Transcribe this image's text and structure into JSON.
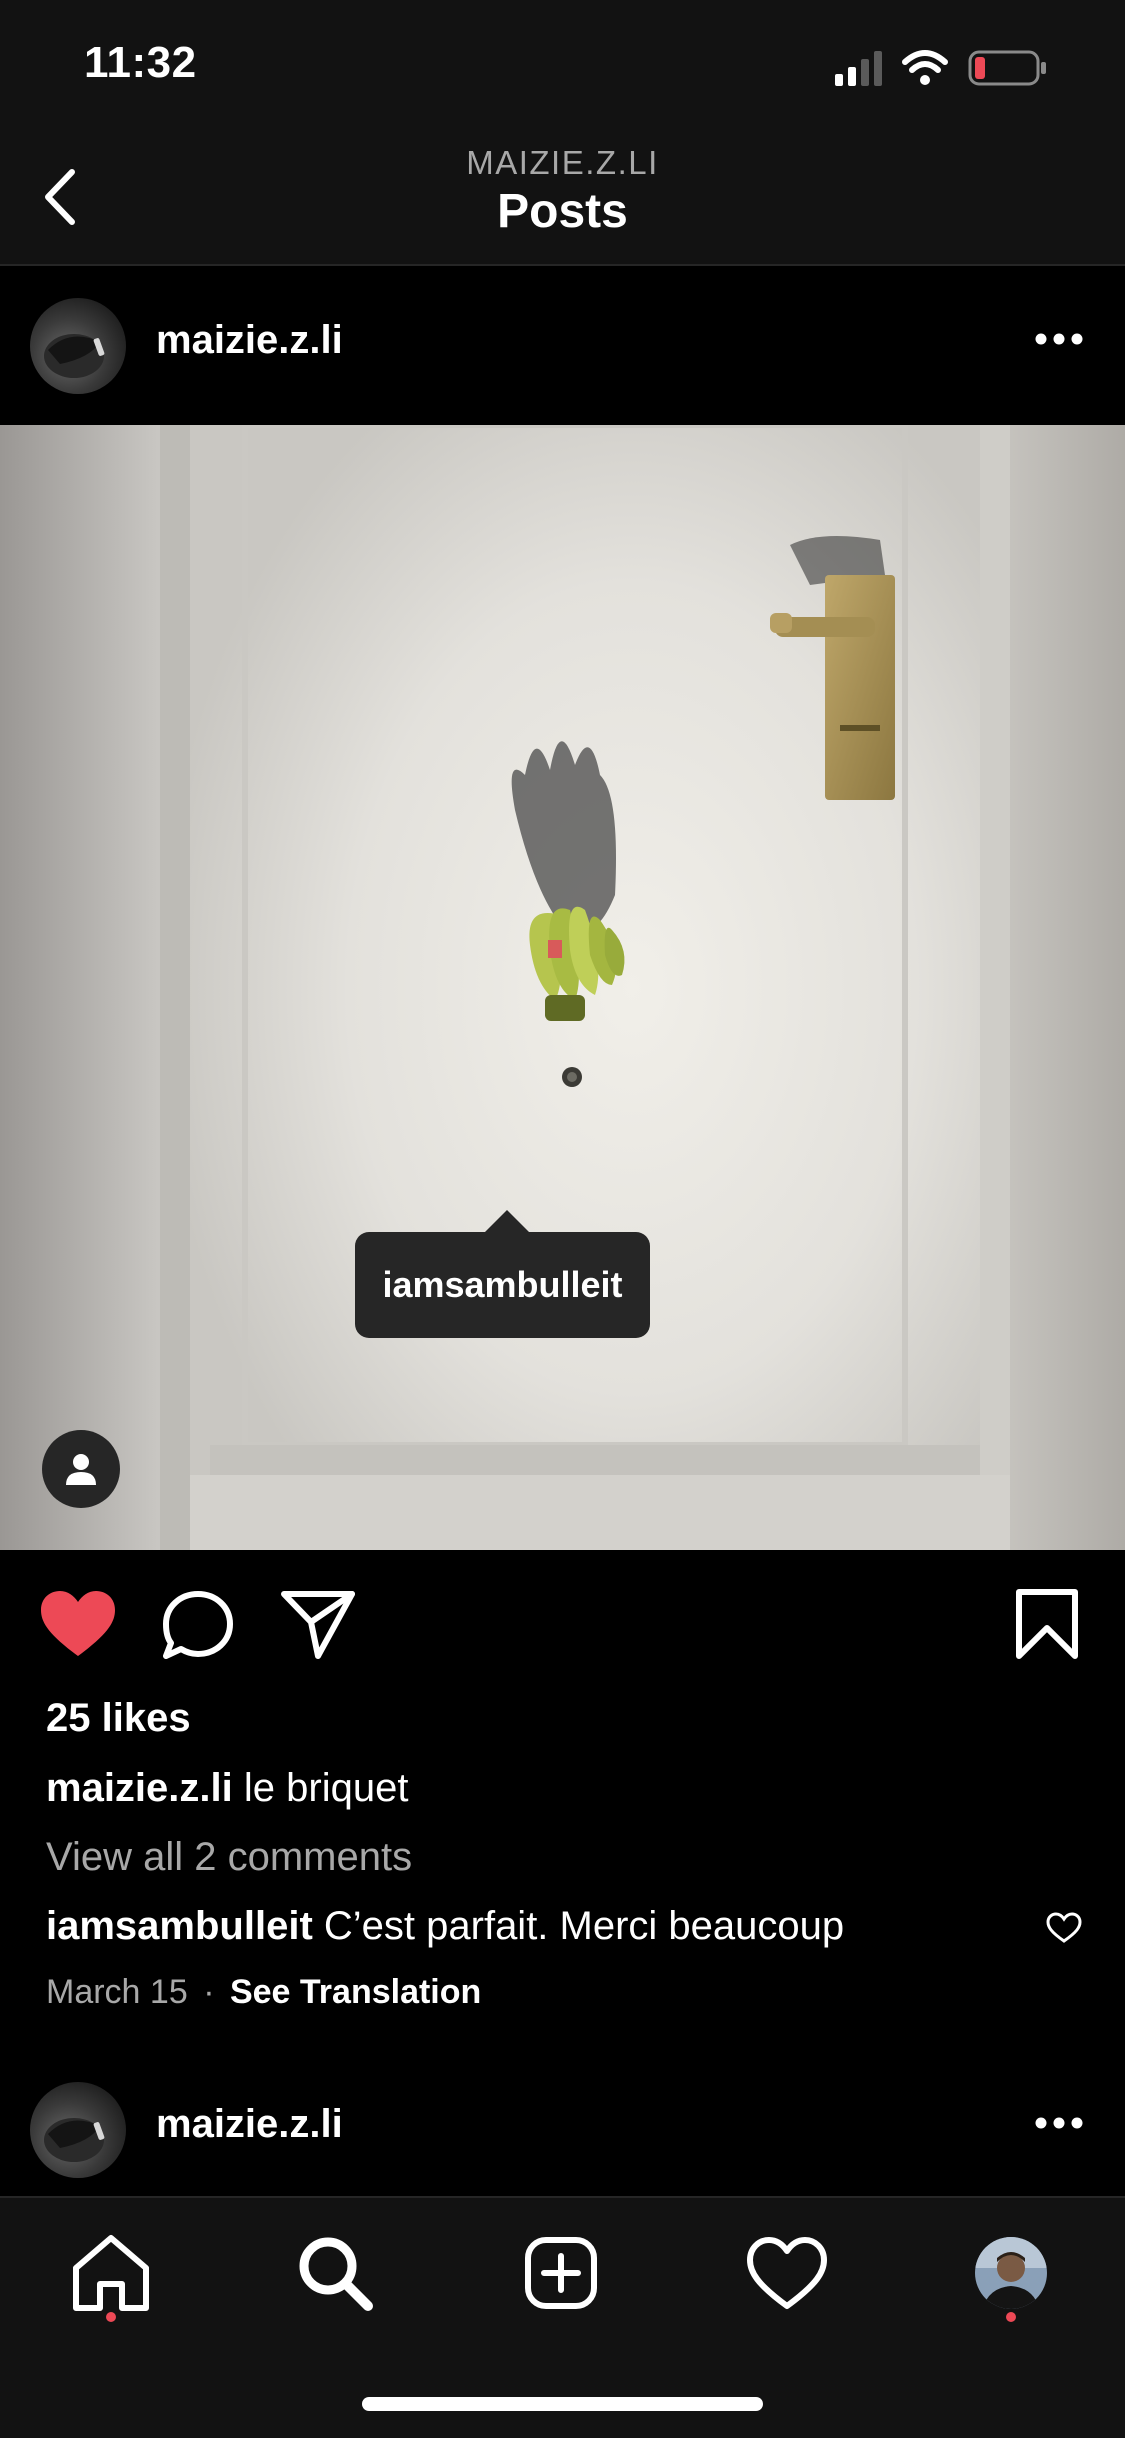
{
  "status_bar": {
    "time": "11:32"
  },
  "nav": {
    "subtitle": "MAIZIE.Z.LI",
    "title": "Posts"
  },
  "post": {
    "username": "maizie.z.li",
    "tagged_user": "iamsambulleit",
    "likes": "25 likes",
    "caption_user": "maizie.z.li",
    "caption_text": "le briquet",
    "view_comments": "View all 2 comments",
    "comment_user": "iamsambulleit",
    "comment_text": "C’est parfait. Merci beaucoup",
    "date": "March 15",
    "date_sep": "·",
    "see_translation": "See Translation"
  },
  "next_post": {
    "username": "maizie.z.li"
  },
  "colors": {
    "background": "#000000",
    "bar": "#121212",
    "liked_heart": "#ed4956",
    "muted_text": "#a8a8a8",
    "battery_low": "#ed4956"
  },
  "icons": {
    "back": "chevron-left-icon",
    "more": "more-horizontal-icon",
    "like": "heart-filled-icon",
    "comment": "comment-bubble-icon",
    "share": "paper-plane-icon",
    "save": "bookmark-icon",
    "tab_home": "home-icon",
    "tab_search": "search-icon",
    "tab_new": "add-post-icon",
    "tab_activity": "heart-outline-icon",
    "tab_profile": "profile-avatar"
  }
}
